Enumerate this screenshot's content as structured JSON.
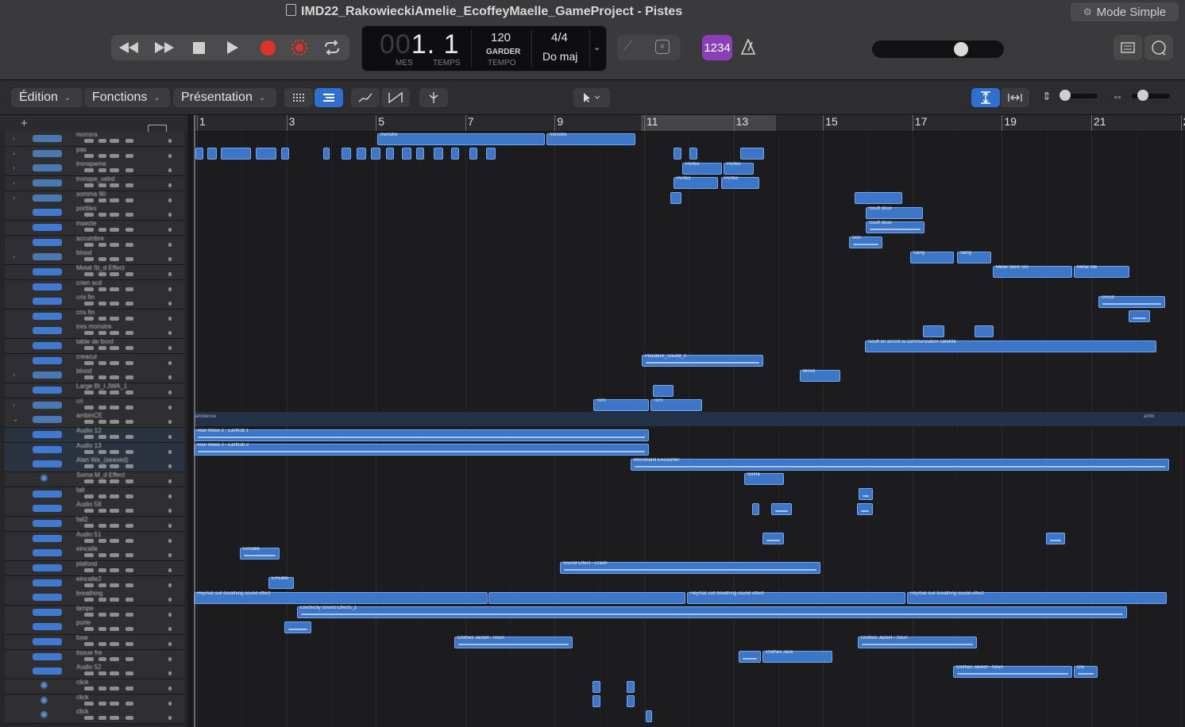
{
  "window": {
    "title": "IMD22_RakowieckiAmelie_EcoffeyMaelle_GameProject - Pistes",
    "mode_simple": "Mode Simple"
  },
  "transport": {
    "buttons": [
      "rewind-icon",
      "fast-forward-icon",
      "stop-icon",
      "play-icon",
      "record-icon",
      "capture-record-icon",
      "cycle-icon"
    ],
    "lcd": {
      "bars": "001. 1",
      "bars_prefix": "00",
      "bars_value": "1. 1",
      "mes": "MES",
      "temps": "TEMPS",
      "tempo": "120",
      "garder": "GARDER",
      "tempo_label": "TEMPO",
      "sig": "4/4",
      "key": "Do maj"
    },
    "count_in": "1234"
  },
  "colors": {
    "accent": "#2e6fcf",
    "region": "#3b76c8",
    "record": "#e0312a",
    "count_in": "#8a3fb8"
  },
  "menus": [
    {
      "label": "Édition"
    },
    {
      "label": "Fonctions"
    },
    {
      "label": "Présentation"
    }
  ],
  "ruler": {
    "bars": [
      "1",
      "3",
      "5",
      "7",
      "9",
      "11",
      "13",
      "15",
      "17",
      "19",
      "21",
      "2"
    ]
  },
  "tracks": [
    "monsra",
    "pas",
    "tronspeme",
    "tronspe_velrd",
    "somma 90",
    "portiles",
    "insecte",
    "accumbre",
    "blood",
    "Metal St_d Effect",
    "crien scd",
    "cris fin",
    "cris fin",
    "tres monstre",
    "table de bord",
    "creacul",
    "blood",
    "Large Bl_I JWA_1",
    "cri",
    "ambinCE",
    "Audio 12",
    "Audio 13",
    "Alan Wa_(seased)",
    "Soma M_d Effect",
    "fall",
    "Audio 58",
    "fall2",
    "Audio 51",
    "eincalle",
    "plafond",
    "eincalle2",
    "breathing",
    "lampe",
    "porte",
    "lose",
    "tissue fre",
    "Audio 52",
    "click",
    "click",
    "click"
  ],
  "regions": {
    "r_monstre": "monstre",
    "r_monstre2": "monstre",
    "r_pas1": "Portes",
    "r_pas2": "Portes",
    "r_pas3": "Portes",
    "r_pas4": "Portes",
    "r_vent": "Souff doux",
    "r_vent2": "Souff doux",
    "r_sori": "Sori",
    "r_sang": "Sang",
    "r_sang2": "Sang",
    "r_metal": "Metal Stom Sm",
    "r_metal2": "Metal Ste",
    "r_crisd": "criscd",
    "r_trans": "Souff en amont la communication satellite",
    "r_plandeck": "Plandeck_Sound_2",
    "r_blood": "Blood",
    "r_large": "Torn",
    "r_large2": "Torn",
    "r_alan1": "Alan Wake 2 - Earthob 1",
    "r_alan2": "Alan Wake 2 - Earthob 2",
    "r_ambience": "ambience",
    "r_ambience2": "ambi",
    "r_meet": "Monstrand Encounter",
    "r_soma": "Soma",
    "r_eincalle": "Eincalle",
    "r_plafond": "Sound Effect - Crash",
    "r_eincalle2": "Eincalle",
    "r_breath1": "Heymat suit breathing sound effect",
    "r_breath2": "Heymat suit breathing sound effect",
    "r_breath3": "Heymat suit breathing sound effect",
    "r_lampe": "Electricity Sound Effects_1",
    "r_tissue1": "Clothes Jacket - Soun",
    "r_tissue2": "Clothes Jacket - Soun",
    "r_tissue3": "Clothes Jack",
    "r_audio52": "Clothes Jacket - Soun",
    "r_audio52b": "Clo"
  }
}
